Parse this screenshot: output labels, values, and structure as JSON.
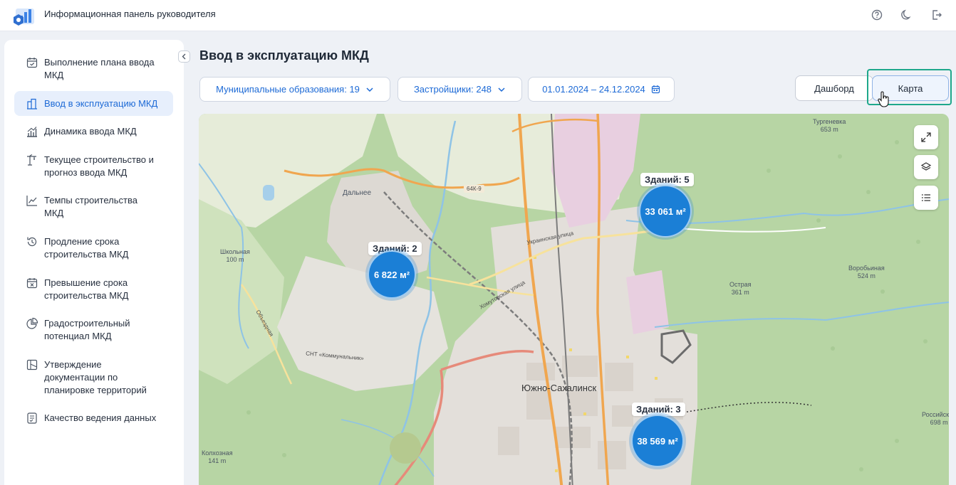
{
  "app": {
    "title": "Информационная панель руководителя"
  },
  "header_icons": [
    "help-icon",
    "moon-icon",
    "logout-icon"
  ],
  "sidebar": {
    "items": [
      {
        "label_lines": [
          "Выполнение плана ввода",
          "МКД"
        ],
        "icon": "calendar-check-icon",
        "active": false
      },
      {
        "label_lines": [
          "Ввод в эксплуатацию МКД"
        ],
        "icon": "building-icon",
        "active": true
      },
      {
        "label_lines": [
          "Динамика ввода МКД"
        ],
        "icon": "bar-chart-icon",
        "active": false
      },
      {
        "label_lines": [
          "Текущее строительство и",
          "прогноз ввода МКД"
        ],
        "icon": "crane-icon",
        "active": false
      },
      {
        "label_lines": [
          "Темпы строительства",
          "МКД"
        ],
        "icon": "line-chart-icon",
        "active": false
      },
      {
        "label_lines": [
          "Продление срока",
          "строительства МКД"
        ],
        "icon": "history-icon",
        "active": false
      },
      {
        "label_lines": [
          "Превышение срока",
          "строительства МКД"
        ],
        "icon": "calendar-x-icon",
        "active": false
      },
      {
        "label_lines": [
          "Градостроительный",
          "потенциал МКД"
        ],
        "icon": "pie-chart-icon",
        "active": false
      },
      {
        "label_lines": [
          "Утверждение",
          "документации по",
          "планировке территорий"
        ],
        "icon": "map-doc-icon",
        "active": false
      },
      {
        "label_lines": [
          "Качество ведения данных"
        ],
        "icon": "checklist-icon",
        "active": false
      }
    ]
  },
  "main": {
    "title": "Ввод в эксплуатацию МКД",
    "filters": {
      "municipalities": "Муниципальные образования: 19",
      "developers": "Застройщики: 248",
      "date_range": "01.01.2024 – 24.12.2024"
    },
    "view_toggle": {
      "dashboard": "Дашборд",
      "map": "Карта",
      "selected": "map"
    }
  },
  "map": {
    "controls": [
      "fullscreen-icon",
      "layers-icon",
      "list-icon"
    ],
    "clusters": [
      {
        "label": "Зданий: 2",
        "value": "6 822 м²"
      },
      {
        "label": "Зданий: 5",
        "value": "33 061 м²"
      },
      {
        "label": "Зданий: 3",
        "value": "38 569 м²"
      }
    ],
    "city": "Южно-Сахалинск",
    "places": [
      {
        "name": "Тургеневка",
        "elev": "653 m"
      },
      {
        "name": "Школьная",
        "elev": "100 m"
      },
      {
        "name": "Дальнее",
        "elev": ""
      },
      {
        "name": "Воробьиная",
        "elev": "524 m"
      },
      {
        "name": "Острая",
        "elev": "361 m"
      },
      {
        "name": "Российская",
        "elev": "698 m"
      },
      {
        "name": "Колхозная",
        "elev": "141 m"
      }
    ],
    "roads": [
      "64К-9",
      "Украинская улица",
      "СНТ «Коммунальник»",
      "Хомутовская улица",
      "Объездная"
    ],
    "colors": {
      "cluster": "#1b7fd6",
      "forest": "#b9d7a6",
      "urban": "#ece8e3",
      "road_major": "#f0a050"
    }
  }
}
